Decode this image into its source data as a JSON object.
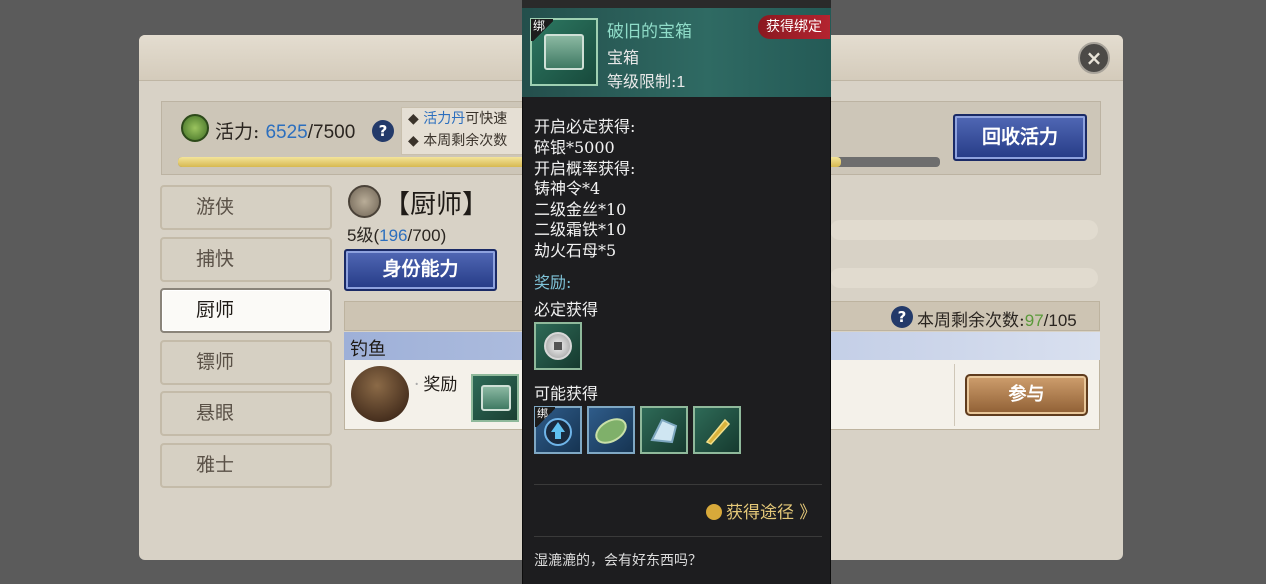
{
  "vigor": {
    "label": "活力:",
    "current": "6525",
    "max": "/7500",
    "help": "?",
    "progress_fraction": 0.87,
    "tip_line1_highlight": "活力丹",
    "tip_line1_rest": "可快速",
    "tip_line2": "本周剩余次数",
    "recycle_button": "回收活力"
  },
  "sidebar": {
    "items": [
      {
        "label": "游侠"
      },
      {
        "label": "捕快"
      },
      {
        "label": "厨师"
      },
      {
        "label": "镖师"
      },
      {
        "label": "悬眼"
      },
      {
        "label": "雅士"
      }
    ],
    "active_index": 2
  },
  "role": {
    "title": "【厨师】",
    "level_prefix": "5级(",
    "exp_current": "196",
    "exp_max": "/700)",
    "ability_button": "身份能力"
  },
  "weekly": {
    "label": "本周剩余次数:",
    "current": "97",
    "max": "/105",
    "help": "?"
  },
  "activity": {
    "name": "钓鱼",
    "reward_label": "奖励",
    "join_button": "参与"
  },
  "tooltip": {
    "item_name": "破旧的宝箱",
    "item_type": "宝箱",
    "level_label": "等级限制:",
    "level_value": "1",
    "badge": "获得绑定",
    "bind_mark": "绑",
    "guaranteed_header": "开启必定获得:",
    "guaranteed": [
      "碎银*5000"
    ],
    "chance_header": "开启概率获得:",
    "chance": [
      "铸神令*4",
      "二级金丝*10",
      "二级霜铁*10",
      "劫火石母*5"
    ],
    "reward_section": "奖励:",
    "must_get": "必定获得",
    "may_get": "可能获得",
    "source_link": "获得途径 》",
    "flavor": "湿漉漉的，会有好东西吗？"
  },
  "colors": {
    "accent_blue": "#2c6fbe",
    "accent_green": "#5a9a3a",
    "tooltip_name": "#8fdcc8",
    "badge_red": "#b42430",
    "section_cyan": "#7fc3d8",
    "link_gold": "#e4c878"
  },
  "icons": [
    "close-icon",
    "vigor-icon",
    "help-icon",
    "chef-icon",
    "fishing-icon",
    "treasure-chest-icon",
    "silver-coin-icon",
    "cast-token-icon",
    "gold-thread-icon",
    "frost-iron-icon",
    "fire-stone-icon",
    "source-icon"
  ]
}
